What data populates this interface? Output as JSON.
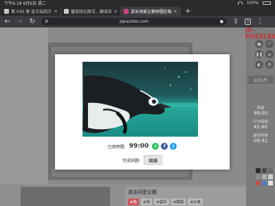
{
  "status_bar": {
    "left_text": "下午6:18  6月6日 週二",
    "battery": "100%"
  },
  "tabs": [
    {
      "label": "第 545 章 宣王出四方 (文"
    },
    {
      "label": "番茄短记原文、翻译及赏析"
    },
    {
      "label": "游泳洞爱企鹅拼圖在線 |"
    }
  ],
  "toolbar": {
    "url": "jspuzzles.com",
    "tab_count": "3"
  },
  "side_panel": {
    "logo": "JS-PUZZLES",
    "pieces_count": "225 片",
    "time_label": "時間",
    "time_value": "99:00",
    "avg_label": "平均時間",
    "avg_value": "41:40",
    "best_label": "最佳時間",
    "best_value": "09:31",
    "swatch_colors": [
      "#2b2b2b",
      "#4a4a4a",
      "#6a6a6a",
      "#8c8c8c",
      "#b0b0b0",
      "#d0d0d0",
      "#c05050",
      "#5a7ec0",
      "#e0e0e0"
    ]
  },
  "modal": {
    "elapsed_label": "已用時間:",
    "elapsed_value": "99:00",
    "completed_label": "完成拼圖!",
    "continue_label": "繼續",
    "share_icons": [
      "whatsapp-icon",
      "facebook-icon",
      "twitter-icon"
    ]
  },
  "bottom": {
    "article_title": "游泳洞愛企鵝",
    "tags": [
      "#鳥",
      "#鳥",
      "#蛋科",
      "#鸚鵡",
      "#水禽"
    ]
  }
}
